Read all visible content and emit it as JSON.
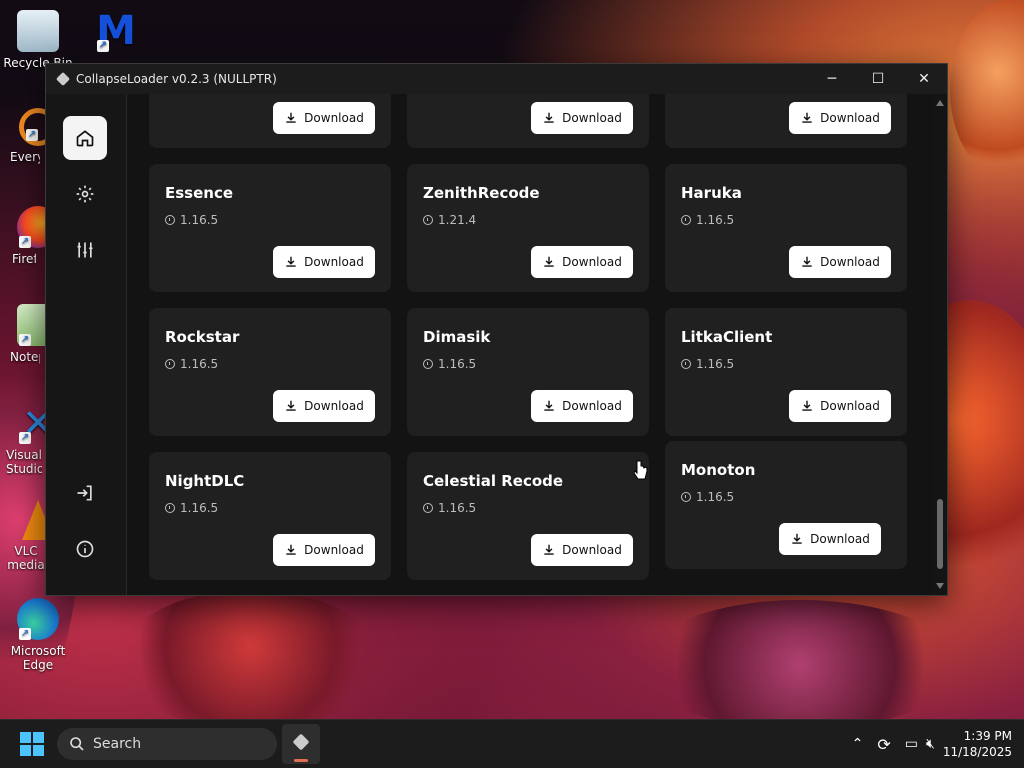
{
  "window": {
    "title": "CollapseLoader v0.2.3 (NULLPTR)",
    "minimize_glyph": "─",
    "maximize_glyph": "☐",
    "close_glyph": "✕"
  },
  "sidebar": {
    "items": [
      {
        "name": "home",
        "icon": "home-icon"
      },
      {
        "name": "settings",
        "icon": "gear-icon"
      },
      {
        "name": "customize",
        "icon": "sliders-icon"
      },
      {
        "name": "login",
        "icon": "login-icon"
      },
      {
        "name": "about",
        "icon": "info-icon"
      }
    ]
  },
  "download_label": "Download",
  "clients": [
    {
      "name": "",
      "version": ""
    },
    {
      "name": "",
      "version": ""
    },
    {
      "name": "",
      "version": ""
    },
    {
      "name": "Essence",
      "version": "1.16.5"
    },
    {
      "name": "ZenithRecode",
      "version": "1.21.4"
    },
    {
      "name": "Haruka",
      "version": "1.16.5"
    },
    {
      "name": "Rockstar",
      "version": "1.16.5"
    },
    {
      "name": "Dimasik",
      "version": "1.16.5"
    },
    {
      "name": "LitkaClient",
      "version": "1.16.5"
    },
    {
      "name": "NightDLC",
      "version": "1.16.5"
    },
    {
      "name": "Celestial Recode",
      "version": "1.16.5"
    },
    {
      "name": "Monoton",
      "version": "1.16.5"
    }
  ],
  "desktop_icons": [
    {
      "label": "Recycle Bin"
    },
    {
      "label": "Malwarebytes"
    },
    {
      "label": "Everything"
    },
    {
      "label": "Firefox"
    },
    {
      "label": "Notepad++"
    },
    {
      "label": "Visual Studio Code"
    },
    {
      "label": "VLC media player"
    },
    {
      "label": "Microsoft Edge"
    }
  ],
  "taskbar": {
    "search_placeholder": "Search",
    "time": "1:39 PM",
    "date": "11/18/2025"
  }
}
